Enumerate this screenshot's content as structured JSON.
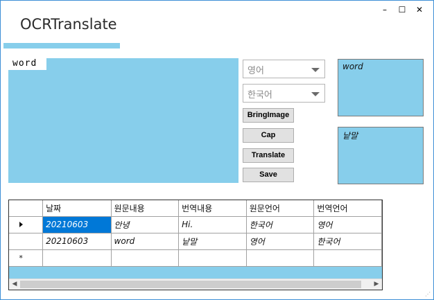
{
  "window": {
    "title": "OCRTranslate",
    "minimize_glyph": "–",
    "maximize_glyph": "☐",
    "close_glyph": "✕"
  },
  "image_panel": {
    "label": "word"
  },
  "source_language": {
    "selected": "영어"
  },
  "target_language": {
    "selected": "한국어"
  },
  "buttons": {
    "bring_image": "BringImage",
    "cap": "Cap",
    "translate": "Translate",
    "save": "Save"
  },
  "results": {
    "recognized_text": "word",
    "translated_text": "낱말"
  },
  "grid": {
    "columns": [
      "날짜",
      "원문내용",
      "번역내용",
      "원문언어",
      "번역언어"
    ],
    "rows": [
      [
        "20210603",
        "안녕",
        "Hi.",
        "한국어",
        "영어"
      ],
      [
        "20210603",
        "word",
        "낱말",
        "영어",
        "한국어"
      ]
    ],
    "new_row_glyph": "*"
  },
  "colors": {
    "panel": "#87ceeb",
    "selection": "#0078d7",
    "window_border": "#3c8fd6"
  }
}
